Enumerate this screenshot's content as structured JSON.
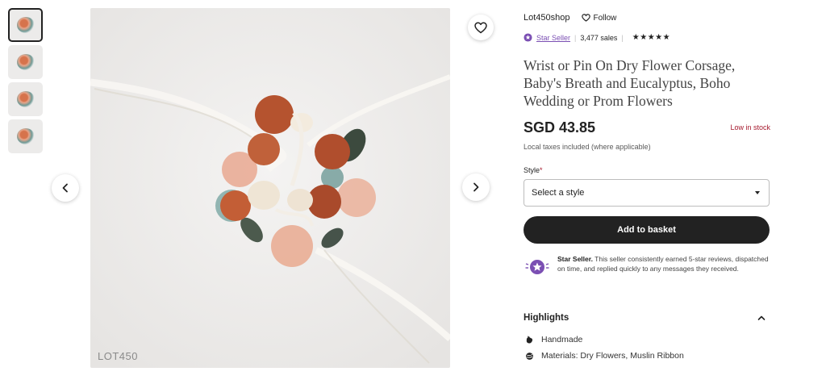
{
  "thumbnails": [
    "thumb-1",
    "thumb-2",
    "thumb-3",
    "thumb-4"
  ],
  "image": {
    "watermark": "LOT450"
  },
  "shop": {
    "name": "Lot450shop",
    "follow_label": "Follow"
  },
  "seller": {
    "star_seller_label": "Star Seller",
    "sales": "3,477 sales",
    "stars": "★★★★★"
  },
  "listing": {
    "title": "Wrist or Pin On Dry Flower Corsage, Baby's Breath and Eucalyptus, Boho Wedding or Prom Flowers",
    "price": "SGD 43.85",
    "stock": "Low in stock",
    "tax_note": "Local taxes included (where applicable)"
  },
  "style_select": {
    "label": "Style",
    "required_mark": "*",
    "placeholder": "Select a style"
  },
  "basket_label": "Add to basket",
  "star_seller_info": {
    "bold": "Star Seller.",
    "text": " This seller consistently earned 5-star reviews, dispatched on time, and replied quickly to any messages they received."
  },
  "highlights": {
    "title": "Highlights",
    "items": [
      "Handmade",
      "Materials: Dry Flowers, Muslin Ribbon"
    ]
  },
  "colors": {
    "accent_purple": "#7b4fb3",
    "stock_red": "#a61a2e",
    "button_dark": "#222222"
  }
}
